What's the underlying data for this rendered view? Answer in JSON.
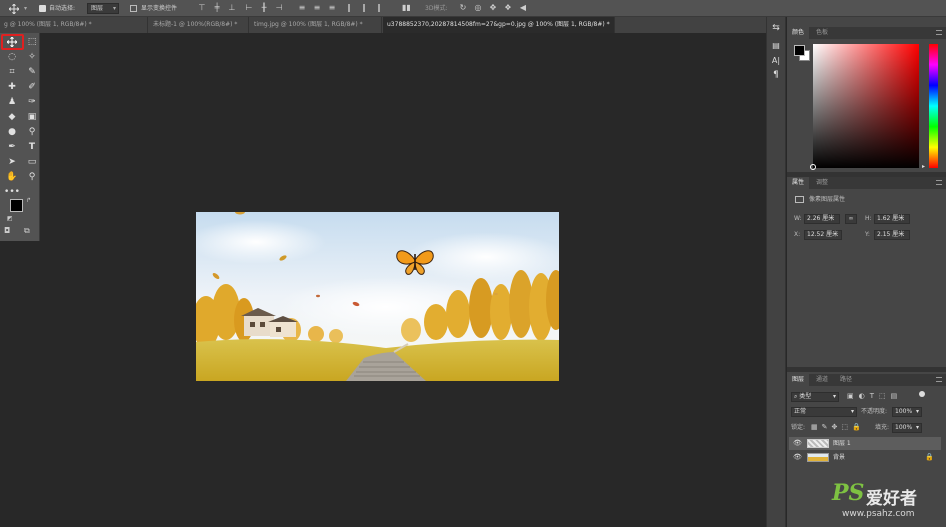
{
  "options_bar": {
    "auto_select_label": "自动选择:",
    "auto_select_value": "图层",
    "show_transform_label": "显示变换控件",
    "mode3d_label": "3D模式:"
  },
  "tabs": [
    {
      "label": "g @ 100% (图层 1, RGB/8#) *",
      "active": false
    },
    {
      "label": "未标题-1 @ 100%(RGB/8#) *",
      "active": false
    },
    {
      "label": "timg.jpg @ 100% (图层 1, RGB/8#) *",
      "active": false
    },
    {
      "label": "u3788852370,20287814508fm=27&gp=0.jpg @ 100% (图层 1, RGB/8#) *",
      "active": true
    }
  ],
  "color_panel": {
    "tabs": [
      "颜色",
      "色板"
    ],
    "fg_color": "#000000",
    "bg_color": "#ffffff",
    "hue_color": "#ff0000"
  },
  "properties_panel": {
    "tabs": [
      "属性",
      "调整"
    ],
    "subtitle": "像素图层属性",
    "w_label": "W:",
    "w_value": "2.26 厘米",
    "h_label": "H:",
    "h_value": "1.62 厘米",
    "x_label": "X:",
    "x_value": "12.52 厘米",
    "y_label": "Y:",
    "y_value": "2.15 厘米"
  },
  "layers_panel": {
    "tabs": [
      "图层",
      "通道",
      "路径"
    ],
    "filter_kind": "类型",
    "blend_mode": "正常",
    "opacity_label": "不透明度:",
    "opacity_value": "100%",
    "lock_label": "锁定:",
    "fill_label": "填充:",
    "fill_value": "100%",
    "layers": [
      {
        "name": "图层 1",
        "selected": true
      },
      {
        "name": "背景",
        "selected": false
      }
    ]
  },
  "watermark": {
    "brand": "PS",
    "cn": "爱好者",
    "url": "www.psahz.com"
  }
}
